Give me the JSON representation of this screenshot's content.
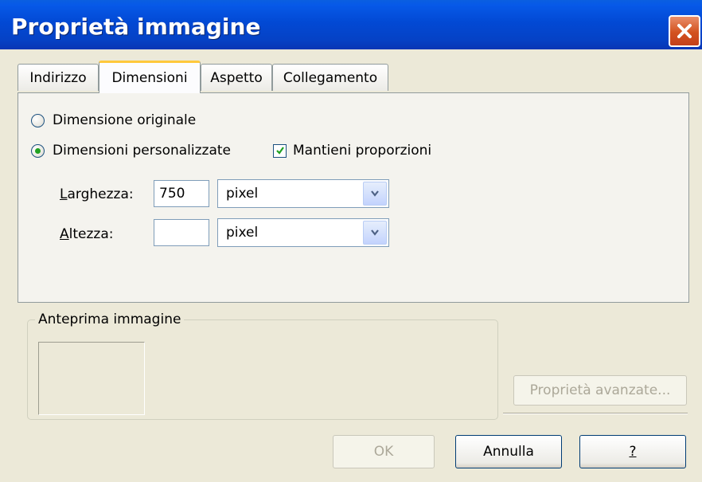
{
  "window": {
    "title": "Proprietà immagine"
  },
  "tabs": [
    {
      "label": "Indirizzo"
    },
    {
      "label": "Dimensioni",
      "active": true
    },
    {
      "label": "Aspetto"
    },
    {
      "label": "Collegamento"
    }
  ],
  "dimensions": {
    "original_label": "Dimensione originale",
    "original_selected": false,
    "custom_label": "Dimensioni personalizzate",
    "custom_selected": true,
    "keep_ratio_label": "Mantieni proporzioni",
    "keep_ratio_checked": true,
    "width_label": "Larghezza:",
    "width_value": "750",
    "width_unit": "pixel",
    "height_label": "Altezza:",
    "height_value": "",
    "height_unit": "pixel"
  },
  "preview": {
    "label": "Anteprima immagine"
  },
  "buttons": {
    "advanced_label": "Proprietà avanzate...",
    "ok_label": "OK",
    "cancel_label": "Annulla",
    "help_label": "?"
  },
  "colors": {
    "titlebar": "#0249d4",
    "close": "#d3521f",
    "active_tab_highlight": "#ffc83c",
    "window_bg": "#ece9d8"
  },
  "icons": {
    "close": "close-icon",
    "dropdown": "chevron-down-icon",
    "check": "checkmark-icon"
  }
}
